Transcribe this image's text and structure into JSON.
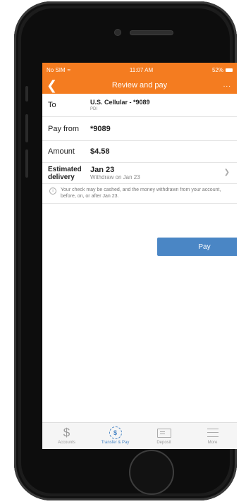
{
  "status_bar": {
    "carrier": "No SIM",
    "time": "11:07 AM",
    "battery": "52%"
  },
  "nav": {
    "title": "Review and pay",
    "more": "..."
  },
  "to": {
    "label": "To",
    "payee": "U.S. Cellular - *9089",
    "payee_sub": "PDI"
  },
  "pay_from": {
    "label": "Pay from",
    "account": "*9089"
  },
  "amount": {
    "label": "Amount",
    "value": "$4.58"
  },
  "delivery": {
    "label_line1": "Estimated",
    "label_line2": "delivery",
    "date": "Jan 23",
    "withdraw": "Withdraw on Jan 23"
  },
  "notice": "Your check may be cashed, and the money withdrawn from your account, before, on, or after Jan 23.",
  "pay_button": "Pay",
  "tabs": [
    {
      "label": "Accounts",
      "icon": "dollar-icon"
    },
    {
      "label": "Transfer & Pay",
      "icon": "transfer-pay-icon"
    },
    {
      "label": "Deposit",
      "icon": "check-deposit-icon"
    },
    {
      "label": "More",
      "icon": "menu-icon"
    }
  ],
  "colors": {
    "accent": "#f47c20",
    "button": "#4a86c5"
  }
}
